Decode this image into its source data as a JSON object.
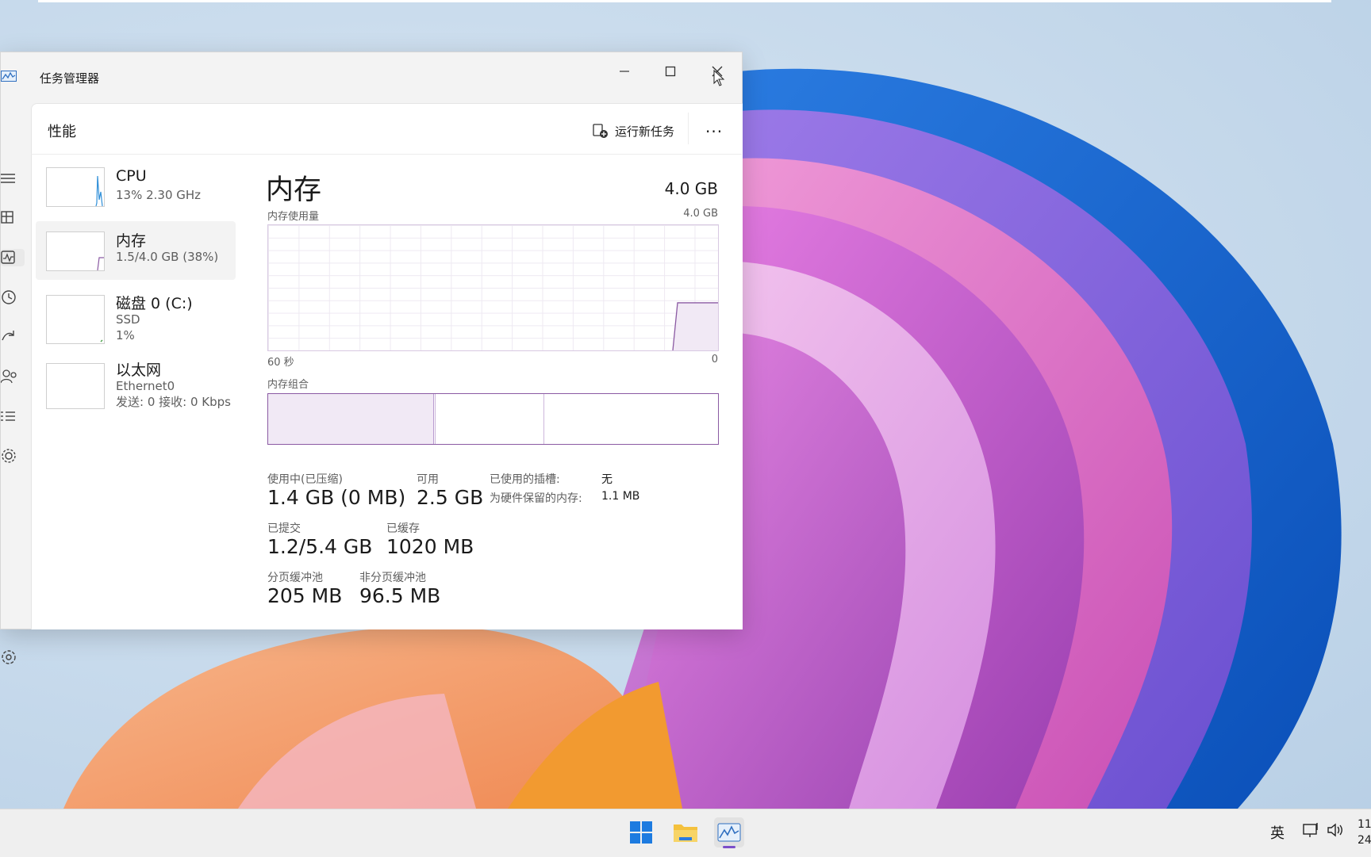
{
  "window": {
    "title": "任务管理器",
    "minimize_label": "–",
    "maximize_label": "☐",
    "close_label": "✕"
  },
  "header": {
    "page_title": "性能",
    "run_task_label": "运行新任务",
    "more_label": "···"
  },
  "nav": {
    "icons": [
      "hamburger-icon",
      "processes-icon",
      "performance-icon",
      "app-history-icon",
      "startup-icon",
      "users-icon",
      "details-icon",
      "services-icon",
      "settings-icon"
    ]
  },
  "sidebar": {
    "items": [
      {
        "name": "CPU",
        "sub1": "13% 2.30 GHz",
        "sub2": "",
        "sub3": ""
      },
      {
        "name": "内存",
        "sub1": "1.5/4.0 GB (38%)",
        "sub2": "",
        "sub3": ""
      },
      {
        "name": "磁盘 0 (C:)",
        "sub1": "SSD",
        "sub2": "1%",
        "sub3": ""
      },
      {
        "name": "以太网",
        "sub1": "Ethernet0",
        "sub2": "发送: 0 接收: 0 Kbps",
        "sub3": ""
      }
    ]
  },
  "main": {
    "title": "内存",
    "total": "4.0 GB",
    "usage_label": "内存使用量",
    "usage_max": "4.0 GB",
    "time_left": "60 秒",
    "time_right": "0",
    "composition_label": "内存组合",
    "usage_fraction": 0.38
  },
  "stats": {
    "in_use_label": "使用中(已压缩)",
    "in_use_value": "1.4 GB (0 MB)",
    "available_label": "可用",
    "available_value": "2.5 GB",
    "committed_label": "已提交",
    "committed_value": "1.2/5.4 GB",
    "cached_label": "已缓存",
    "cached_value": "1020 MB",
    "paged_label": "分页缓冲池",
    "paged_value": "205 MB",
    "nonpaged_label": "非分页缓冲池",
    "nonpaged_value": "96.5 MB",
    "slots_label": "已使用的插槽:",
    "slots_value": "无",
    "reserved_label": "为硬件保留的内存:",
    "reserved_value": "1.1 MB"
  },
  "taskbar": {
    "ime_label": "英",
    "clock_line1": "11",
    "clock_line2": "24"
  },
  "colors": {
    "memory_accent": "#8b5aa3",
    "memory_fill": "#f1e9f5",
    "cpu_accent": "#2f8fd8",
    "disk_accent": "#4aa14a"
  }
}
